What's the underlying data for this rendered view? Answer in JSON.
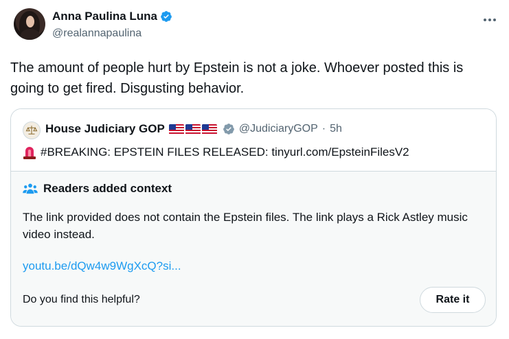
{
  "author": {
    "name": "Anna Paulina Luna",
    "handle": "@realannapaulina",
    "verified_color": "#1d9bf0"
  },
  "tweet": {
    "text": "The amount of people hurt by Epstein is not a joke. Whoever posted this is going to get fired. Disgusting behavior."
  },
  "quoted": {
    "name": "House Judiciary GOP",
    "handle": "@JudiciaryGOP",
    "separator": "·",
    "time": "5h",
    "text": "#BREAKING: EPSTEIN FILES RELEASED: tinyurl.com/EpsteinFilesV2",
    "icon": "police-siren-icon"
  },
  "context": {
    "title": "Readers added context",
    "body": "The link provided does not contain the Epstein files. The link plays a Rick Astley music video instead.",
    "link": "youtu.be/dQw4w9WgXcQ?si...",
    "helpful_prompt": "Do you find this helpful?",
    "rate_label": "Rate it",
    "link_color": "#1d9bf0"
  }
}
